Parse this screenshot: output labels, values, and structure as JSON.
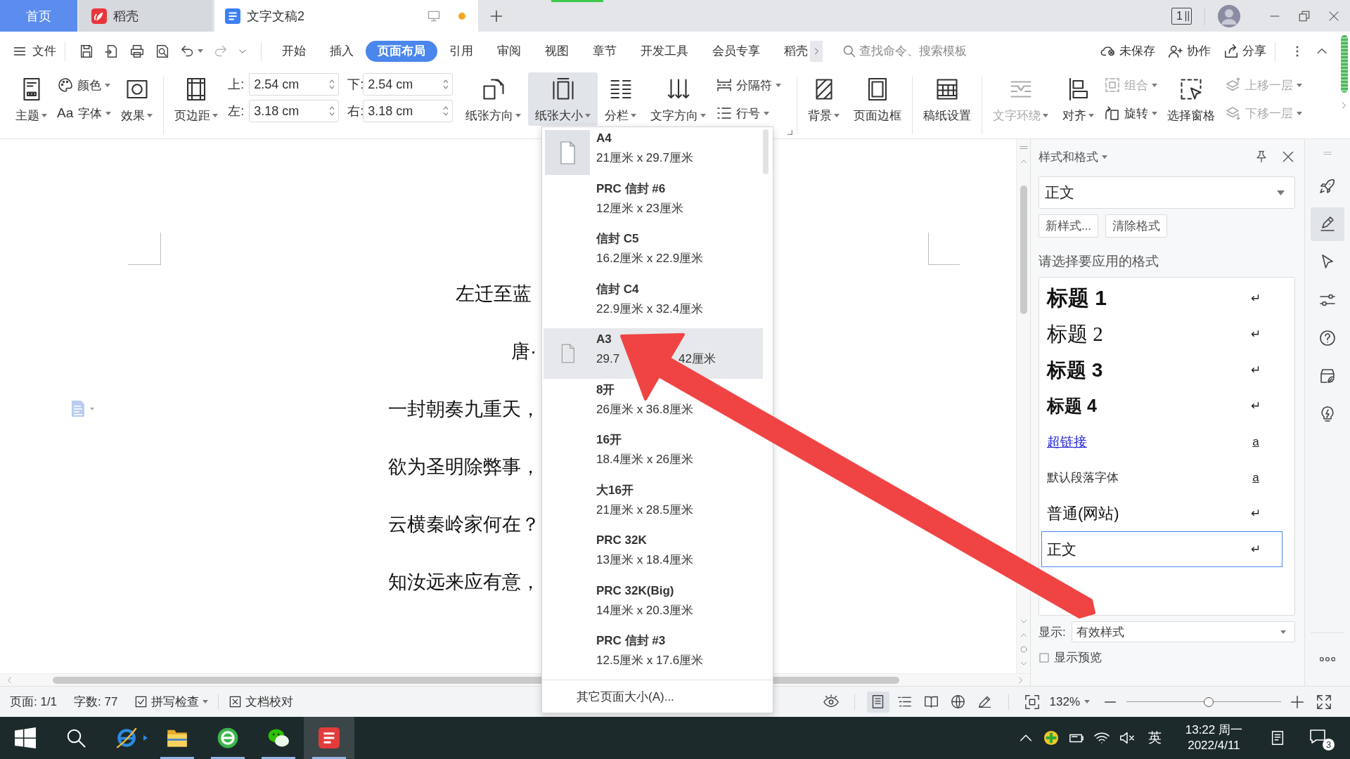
{
  "title_bar": {
    "tabs": [
      {
        "label": "首页",
        "kind": "home",
        "selected": false,
        "unsaved": false
      },
      {
        "label": "稻壳",
        "kind": "store",
        "selected": false,
        "unsaved": false
      },
      {
        "label": "文字文稿2",
        "kind": "document",
        "selected": true,
        "unsaved": true
      }
    ],
    "window_count": "1"
  },
  "menu_bar": {
    "file": "文件",
    "quick_access": [
      {
        "disabled": false
      },
      {
        "disabled": false
      },
      {
        "disabled": false
      },
      {
        "disabled": false
      },
      {
        "disabled": false
      },
      {
        "disabled": true
      }
    ],
    "tabs": [
      {
        "label": "开始",
        "selected": false
      },
      {
        "label": "插入",
        "selected": false
      },
      {
        "label": "页面布局",
        "selected": true
      },
      {
        "label": "引用",
        "selected": false
      },
      {
        "label": "审阅",
        "selected": false
      },
      {
        "label": "视图",
        "selected": false
      },
      {
        "label": "章节",
        "selected": false
      },
      {
        "label": "开发工具",
        "selected": false
      },
      {
        "label": "会员专享",
        "selected": false
      },
      {
        "label": "稻壳",
        "selected": false
      }
    ],
    "search": {
      "placeholder": "查找命令、搜索模板"
    },
    "actions": [
      "未保存",
      "协作",
      "分享"
    ]
  },
  "ribbon": {
    "groups": [
      {
        "controls": [
          {
            "kind": "large",
            "label": "主题",
            "dropdown": true,
            "disabled": false,
            "open": false
          },
          {
            "kind": "stack",
            "buttons": [
              {
                "label": "颜色",
                "dropdown": true,
                "disabled": false
              },
              {
                "label": "字体",
                "prefix": "Aa",
                "dropdown": true,
                "disabled": false
              }
            ]
          },
          {
            "kind": "large",
            "label": "效果",
            "dropdown": true,
            "disabled": false,
            "open": false
          }
        ]
      },
      {
        "controls": [
          {
            "kind": "large",
            "label": "页边距",
            "dropdown": true,
            "disabled": false,
            "open": false
          },
          {
            "kind": "margins",
            "fields": [
              {
                "label": "上:",
                "value": "2.54 cm"
              },
              {
                "label": "下:",
                "value": "2.54 cm"
              },
              {
                "label": "左:",
                "value": "3.18 cm"
              },
              {
                "label": "右:",
                "value": "3.18 cm"
              }
            ]
          },
          {
            "kind": "large",
            "label": "纸张方向",
            "dropdown": true,
            "disabled": false,
            "open": false
          },
          {
            "kind": "large",
            "label": "纸张大小",
            "dropdown": true,
            "disabled": false,
            "open": true
          },
          {
            "kind": "large",
            "label": "分栏",
            "dropdown": true,
            "disabled": false,
            "open": false
          },
          {
            "kind": "large",
            "label": "文字方向",
            "dropdown": true,
            "disabled": false,
            "open": false
          },
          {
            "kind": "stack",
            "buttons": [
              {
                "label": "分隔符",
                "dropdown": true,
                "disabled": false
              },
              {
                "label": "行号",
                "dropdown": true,
                "disabled": false
              }
            ]
          }
        ]
      },
      {
        "controls": [
          {
            "kind": "large",
            "label": "背景",
            "dropdown": true,
            "disabled": false,
            "open": false
          },
          {
            "kind": "large",
            "label": "页面边框",
            "dropdown": false,
            "disabled": false,
            "open": false
          }
        ]
      },
      {
        "controls": [
          {
            "kind": "large",
            "label": "稿纸设置",
            "dropdown": false,
            "disabled": false,
            "open": false
          }
        ]
      },
      {
        "controls": [
          {
            "kind": "large",
            "label": "文字环绕",
            "dropdown": true,
            "disabled": true,
            "open": false
          },
          {
            "kind": "large",
            "label": "对齐",
            "dropdown": true,
            "disabled": false,
            "open": false
          },
          {
            "kind": "stack",
            "buttons": [
              {
                "label": "组合",
                "dropdown": true,
                "disabled": true
              },
              {
                "label": "旋转",
                "dropdown": true,
                "disabled": false
              }
            ]
          },
          {
            "kind": "large",
            "label": "选择窗格",
            "dropdown": false,
            "disabled": false,
            "open": false
          },
          {
            "kind": "stack",
            "buttons": [
              {
                "label": "上移一层",
                "dropdown": true,
                "disabled": true
              },
              {
                "label": "下移一层",
                "dropdown": true,
                "disabled": true
              }
            ]
          }
        ]
      }
    ]
  },
  "paper_menu": {
    "items": [
      {
        "name": "A4",
        "size": [
          "21厘米 x 29.7厘米"
        ],
        "selected": true,
        "highlighted": false
      },
      {
        "name": "PRC 信封 #6",
        "size": [
          "12厘米 x 23厘米"
        ],
        "selected": false,
        "highlighted": false
      },
      {
        "name": "信封 C5",
        "size": [
          "16.2厘米 x 22.9厘米"
        ],
        "selected": false,
        "highlighted": false
      },
      {
        "name": "信封 C4",
        "size": [
          "22.9厘米 x 32.4厘米"
        ],
        "selected": false,
        "highlighted": false
      },
      {
        "name": "A3",
        "size": [
          "29.7",
          "42厘米"
        ],
        "selected": false,
        "highlighted": true
      },
      {
        "name": "8开",
        "size": [
          "26厘米 x 36.8厘米"
        ],
        "selected": false,
        "highlighted": false
      },
      {
        "name": "16开",
        "size": [
          "18.4厘米 x 26厘米"
        ],
        "selected": false,
        "highlighted": false
      },
      {
        "name": "大16开",
        "size": [
          "21厘米 x 28.5厘米"
        ],
        "selected": false,
        "highlighted": false
      },
      {
        "name": "PRC 32K",
        "size": [
          "13厘米 x 18.4厘米"
        ],
        "selected": false,
        "highlighted": false
      },
      {
        "name": "PRC 32K(Big)",
        "size": [
          "14厘米 x 20.3厘米"
        ],
        "selected": false,
        "highlighted": false
      },
      {
        "name": "PRC 信封 #3",
        "size": [
          "12.5厘米 x 17.6厘米"
        ],
        "selected": false,
        "highlighted": false
      }
    ],
    "more": "其它页面大小(A)..."
  },
  "document": {
    "lines": [
      {
        "text": "左迁至蓝",
        "kind": "title"
      },
      {
        "text": "唐·",
        "kind": "author"
      },
      {
        "text": "一封朝奏九重天，",
        "kind": "verse"
      },
      {
        "text": "欲为圣明除弊事，",
        "kind": "verse"
      },
      {
        "text": "云横秦岭家何在？",
        "kind": "verse"
      },
      {
        "text": "知汝远来应有意，",
        "kind": "verse"
      }
    ]
  },
  "styles_panel": {
    "title": "样式和格式",
    "current": "正文",
    "buttons": [
      "新样式...",
      "清除格式"
    ],
    "prompt": "请选择要应用的格式",
    "styles": [
      {
        "label": "标题 1",
        "kind": "heading1",
        "mark": "↵",
        "selected": false
      },
      {
        "label": "标题 2",
        "kind": "heading2",
        "mark": "↵",
        "selected": false
      },
      {
        "label": "标题 3",
        "kind": "heading3",
        "mark": "↵",
        "selected": false
      },
      {
        "label": "标题 4",
        "kind": "heading4",
        "mark": "↵",
        "selected": false
      },
      {
        "label": "超链接",
        "kind": "link",
        "mark": "a",
        "selected": false
      },
      {
        "label": "默认段落字体",
        "kind": "plain",
        "mark": "a",
        "selected": false
      },
      {
        "label": "普通(网站)",
        "kind": "web",
        "mark": "↵",
        "selected": false
      },
      {
        "label": "正文",
        "kind": "body",
        "mark": "↵",
        "selected": true
      }
    ],
    "show_label": "显示:",
    "show_value": "有效样式",
    "preview": {
      "label": "显示预览",
      "checked": false
    }
  },
  "side_tools": [
    {
      "selected": false
    },
    {
      "selected": true
    },
    {
      "selected": false
    },
    {
      "selected": false
    },
    {
      "selected": false
    },
    {
      "selected": false
    },
    {
      "selected": false
    }
  ],
  "status_bar": {
    "page": "页面: 1/1",
    "words": "字数: 77",
    "spell_check": "拼写检查",
    "proofread": "文档校对",
    "views": [
      {
        "selected": true
      },
      {
        "selected": false
      },
      {
        "selected": false
      },
      {
        "selected": false
      },
      {
        "selected": false
      }
    ],
    "zoom": "132%",
    "zoom_slider": {
      "level": 0.53
    }
  },
  "taskbar": {
    "apps": [
      {
        "running": false,
        "selected": false
      },
      {
        "running": true,
        "selected": false
      },
      {
        "running": true,
        "selected": false
      },
      {
        "running": true,
        "selected": false
      },
      {
        "running": true,
        "selected": true
      }
    ],
    "input_method": "英",
    "time": "13:22 周一",
    "date": "2022/4/11",
    "notification_count": "3"
  },
  "annotations": [
    {
      "kind": "arrow"
    }
  ]
}
